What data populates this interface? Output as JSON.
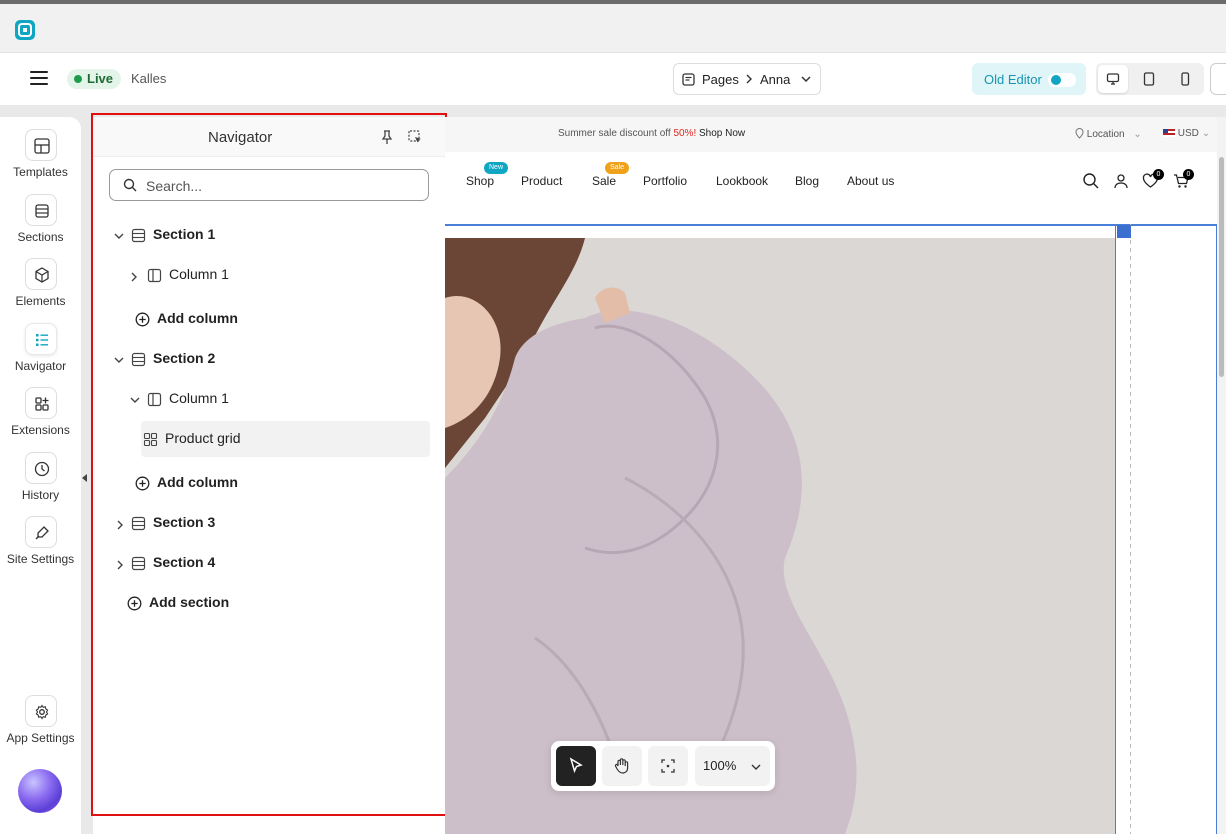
{
  "header": {
    "live_label": "Live",
    "store_name": "Kalles",
    "pages_label": "Pages",
    "page_name": "Anna",
    "old_editor_label": "Old Editor"
  },
  "sidebar": {
    "items": [
      {
        "label": "Templates",
        "icon": "templates-icon"
      },
      {
        "label": "Sections",
        "icon": "sections-icon"
      },
      {
        "label": "Elements",
        "icon": "elements-icon"
      },
      {
        "label": "Navigator",
        "icon": "navigator-icon",
        "active": true
      },
      {
        "label": "Extensions",
        "icon": "extensions-icon"
      },
      {
        "label": "History",
        "icon": "history-icon"
      },
      {
        "label": "Site Settings",
        "icon": "site-settings-icon"
      },
      {
        "label": "App Settings",
        "icon": "app-settings-icon"
      }
    ]
  },
  "navigator": {
    "title": "Navigator",
    "search_placeholder": "Search...",
    "tree": [
      {
        "label": "Section 1",
        "type": "section"
      },
      {
        "label": "Column 1",
        "type": "column"
      },
      {
        "label": "Add column",
        "type": "add"
      },
      {
        "label": "Section 2",
        "type": "section"
      },
      {
        "label": "Column 1",
        "type": "column"
      },
      {
        "label": "Product grid",
        "type": "element",
        "selected": true
      },
      {
        "label": "Add column",
        "type": "add"
      },
      {
        "label": "Section 3",
        "type": "section"
      },
      {
        "label": "Section 4",
        "type": "section"
      },
      {
        "label": "Add section",
        "type": "add"
      }
    ]
  },
  "preview": {
    "announcement": {
      "before": "Summer sale discount off ",
      "highlight": "50%!",
      "link": " Shop Now"
    },
    "location": "Location",
    "currency": "USD",
    "menu": [
      {
        "label": "Shop",
        "badge": "New",
        "badge_color": "#10a6c3"
      },
      {
        "label": "Product"
      },
      {
        "label": "Sale",
        "badge": "Sale",
        "badge_color": "#f0a11a"
      },
      {
        "label": "Portfolio"
      },
      {
        "label": "Lookbook"
      },
      {
        "label": "Blog"
      },
      {
        "label": "About us"
      }
    ],
    "wishlist_count": "0",
    "cart_count": "0"
  },
  "toolbar": {
    "zoom": "100%"
  },
  "colors": {
    "brand": "#10a6c3",
    "live_green": "#1f9c4b",
    "highlight_border": "#e01010",
    "selection_blue": "#4a7fd9"
  }
}
